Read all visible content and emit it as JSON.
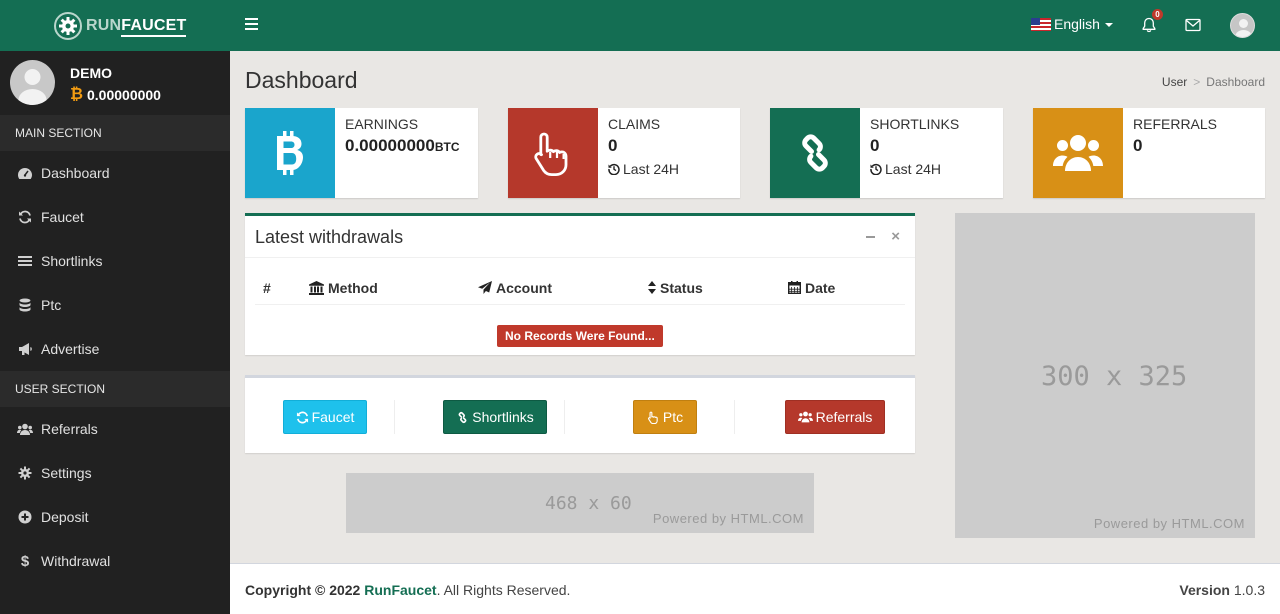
{
  "header": {
    "logo_run": "RUN",
    "logo_faucet": "FAUCET",
    "language": "English",
    "notification_count": "0"
  },
  "sidebar": {
    "user_name": "DEMO",
    "user_balance": "0.00000000",
    "main_section_label": "MAIN SECTION",
    "main_items": [
      {
        "label": "Dashboard",
        "icon": "dashboard-icon"
      },
      {
        "label": "Faucet",
        "icon": "refresh-icon"
      },
      {
        "label": "Shortlinks",
        "icon": "bars-icon"
      },
      {
        "label": "Ptc",
        "icon": "database-icon"
      },
      {
        "label": "Advertise",
        "icon": "bullhorn-icon"
      }
    ],
    "user_section_label": "USER SECTION",
    "user_items": [
      {
        "label": "Referrals",
        "icon": "users-icon"
      },
      {
        "label": "Settings",
        "icon": "gear-icon"
      },
      {
        "label": "Deposit",
        "icon": "plus-circle-icon"
      },
      {
        "label": "Withdrawal",
        "icon": "dollar-icon"
      }
    ]
  },
  "page": {
    "title": "Dashboard",
    "breadcrumb": [
      "User",
      "Dashboard"
    ]
  },
  "stats": {
    "earnings": {
      "label": "EARNINGS",
      "value": "0.00000000",
      "unit": "BTC",
      "color": "#1aa5cc"
    },
    "claims": {
      "label": "CLAIMS",
      "value": "0",
      "sub": "Last 24H",
      "color": "#b5382b"
    },
    "shortlinks": {
      "label": "SHORTLINKS",
      "value": "0",
      "sub": "Last 24H",
      "color": "#146e53"
    },
    "referrals": {
      "label": "REFERRALS",
      "value": "0",
      "color": "#d89016"
    }
  },
  "withdrawals": {
    "title": "Latest withdrawals",
    "columns": [
      "#",
      "Method",
      "Account",
      "Status",
      "Date"
    ],
    "empty_message": "No Records Were Found..."
  },
  "quick_buttons": [
    {
      "label": "Faucet",
      "color": "#1ec1ec"
    },
    {
      "label": "Shortlinks",
      "color": "#146e53"
    },
    {
      "label": "Ptc",
      "color": "#d89016"
    },
    {
      "label": "Referrals",
      "color": "#b5382b"
    }
  ],
  "ads": {
    "banner_size": "468 x 60",
    "box_size": "300 x 325",
    "powered": "Powered by HTML.COM"
  },
  "footer": {
    "copyright_prefix": "Copyright © 2022",
    "brand": "RunFaucet",
    "rights": ". All Rights Reserved.",
    "version_label": "Version",
    "version": "1.0.3"
  }
}
